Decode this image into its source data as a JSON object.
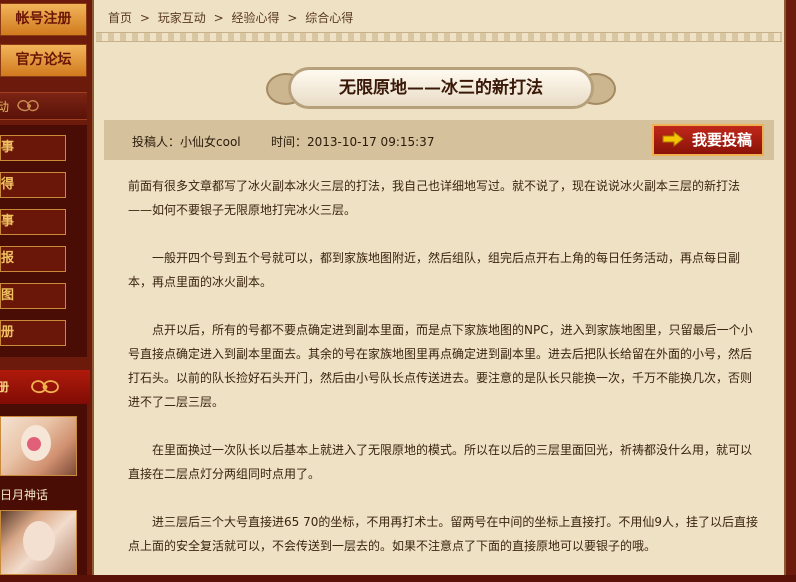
{
  "sidebar": {
    "register_label": "帐号注册",
    "forum_label": "官方论坛",
    "section1_label": "动",
    "menu_items": [
      "事",
      "得",
      "事",
      "报",
      "图",
      "册"
    ],
    "section2_label": "册",
    "thumb_caption": "日月神话"
  },
  "breadcrumb": {
    "home": "首页",
    "sep1": ">",
    "level1": "玩家互动",
    "sep2": ">",
    "level2": "经验心得",
    "sep3": ">",
    "level3": "综合心得"
  },
  "article": {
    "title": "无限原地——冰三的新打法",
    "author": "投稿人：小仙女cool",
    "time": "时间：2013-10-17 09:15:37",
    "submit_label": "我要投稿",
    "paragraphs": [
      "前面有很多文章都写了冰火副本冰火三层的打法，我自己也详细地写过。就不说了，现在说说冰火副本三层的新打法——如何不要银子无限原地打完冰火三层。",
      "一般开四个号到五个号就可以，都到家族地图附近，然后组队，组完后点开右上角的每日任务活动，再点每日副本，再点里面的冰火副本。",
      "点开以后，所有的号都不要点确定进到副本里面，而是点下家族地图的NPC，进入到家族地图里，只留最后一个小号直接点确定进入到副本里面去。其余的号在家族地图里再点确定进到副本里。进去后把队长给留在外面的小号，然后打石头。以前的队长捡好石头开门，然后由小号队长点传送进去。要注意的是队长只能换一次，千万不能换几次，否则进不了二层三层。",
      "在里面换过一次队长以后基本上就进入了无限原地的模式。所以在以后的三层里面回光，祈祷都没什么用，就可以直接在二层点灯分两组同时点用了。",
      "进三层后三个大号直接进65 70的坐标，不用再打术士。留两号在中间的坐标上直接打。不用仙9人，挂了以后直接点上面的安全复活就可以，不会传送到一层去的。如果不注意点了下面的直接原地可以要银子的哦。"
    ]
  },
  "colors": {
    "page_bg": "#eee1c4",
    "sidebar_bg": "#6b1a0c",
    "submit_button": "#b01e12",
    "title_text": "#3a1808"
  }
}
